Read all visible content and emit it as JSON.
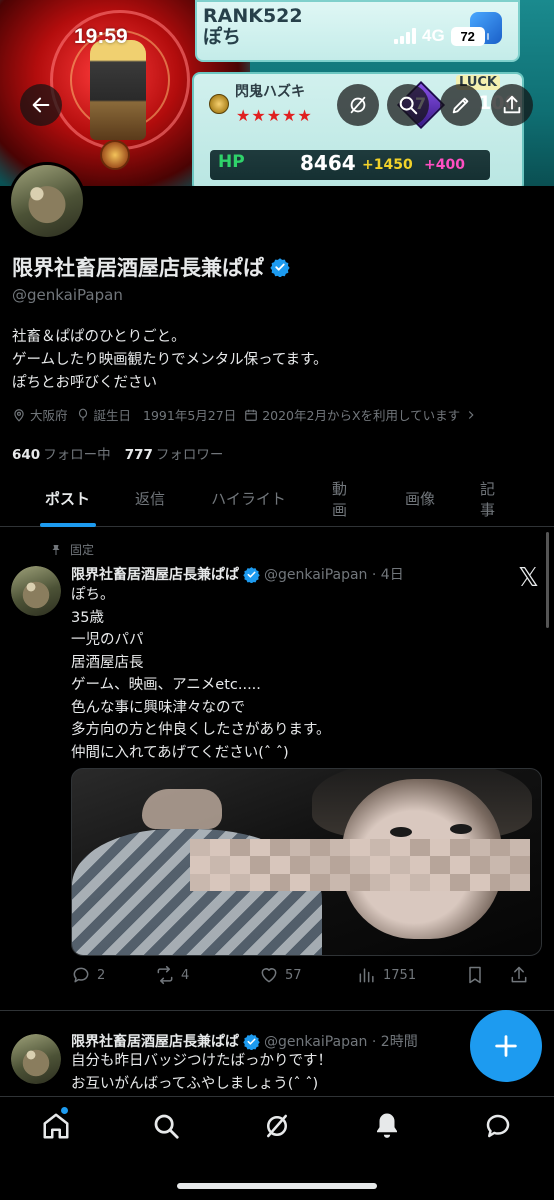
{
  "status_bar": {
    "time": "19:59",
    "network": "4G",
    "battery": "72"
  },
  "banner": {
    "rank_line1": "RANK522",
    "rank_line2": "ぽち",
    "character_name": "閃鬼ハズキ",
    "stars": "★★★★★",
    "hp_label": "HP",
    "hp_value": "8464",
    "hp_bonus1": "+1450",
    "hp_bonus2": "+400",
    "luck_label": "LUCK",
    "luck_value": "100",
    "gem_value": "7"
  },
  "profile": {
    "display_name": "限界社畜居酒屋店長兼ぱぱ",
    "handle": "@genkaiPapan",
    "bio": "社畜＆ぱぱのひとりごと。\nゲームしたり映画観たりでメンタル保ってます。\nぽちとお呼びください",
    "location": "大阪府",
    "birthday_label": "誕生日",
    "birthday": "1991年5月27日",
    "joined": "2020年2月からXを利用しています",
    "following_count": "640",
    "following_label": "フォロー中",
    "followers_count": "777",
    "followers_label": "フォロワー"
  },
  "tabs": [
    {
      "label": "ポスト",
      "active": true
    },
    {
      "label": "返信",
      "active": false
    },
    {
      "label": "ハイライト",
      "active": false
    },
    {
      "label": "動画",
      "active": false
    },
    {
      "label": "画像",
      "active": false
    },
    {
      "label": "記事",
      "active": false
    }
  ],
  "posts": [
    {
      "pinned_label": "固定",
      "name": "限界社畜居酒屋店長兼ぱぱ",
      "handle_time": "@genkaiPapan · 4日",
      "text": "ぽち。\n35歳\n一児のパパ\n居酒屋店長\nゲーム、映画、アニメetc.....\n色んな事に興味津々なので\n多方向の方と仲良くしたさがあります。\n仲間に入れてあげてください(ˆ ˆ)",
      "replies": "2",
      "reposts": "4",
      "likes": "57",
      "views": "1751"
    },
    {
      "name": "限界社畜居酒屋店長兼ぱぱ",
      "handle_time": "@genkaiPapan · 2時間",
      "text": "自分も昨日バッジつけたばっかりです！\nお互いがんばってふやしましょう(ˆ ˆ)"
    }
  ],
  "x_logo": "𝕏",
  "colors": {
    "accent": "#1d9bf0",
    "background": "#000000",
    "secondary_text": "#71767b",
    "primary_text": "#e7e9ea"
  }
}
